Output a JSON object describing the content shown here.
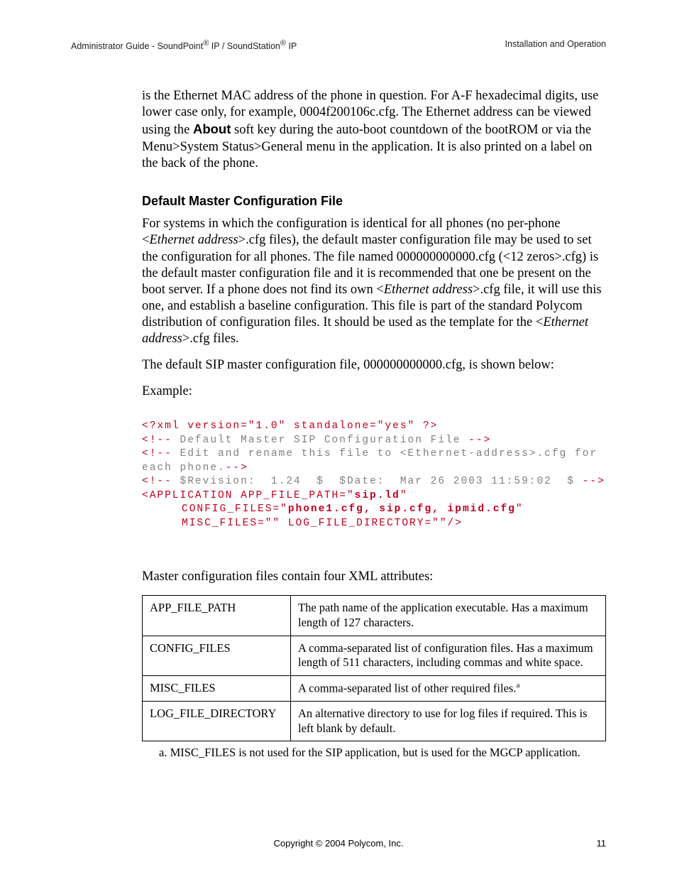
{
  "header": {
    "left_a": "Administrator Guide - SoundPoint",
    "left_reg1": "®",
    "left_b": " IP / SoundStation",
    "left_reg2": "®",
    "left_c": " IP",
    "right": "Installation and Operation"
  },
  "para1_a": "is the Ethernet MAC address of the phone in question.  For A-F hexadecimal digits, use lower case only, for example, 0004f200106c.cfg.  The Ethernet address can be viewed using the ",
  "para1_about": "About",
  "para1_b": " soft key during the auto-boot countdown of the bootROM or via the Menu>System Status>General menu in the application.  It is also printed on a label on the back of the phone.",
  "section_title": "Default Master Configuration File",
  "para2_a": "For systems in which the configuration is identical for all phones (no per-phone <",
  "para2_i1": "Ethernet address",
  "para2_b": ">.cfg files), the default master configuration file may be used to set the configuration for all phones.  The file named 000000000000.cfg (<12 zeros>.cfg) is the default master configuration file and it is recommended that one be present on the boot server.  If a phone does not find its own <",
  "para2_i2": "Ethernet address",
  "para2_c": ">.cfg file, it will use this one, and establish a baseline configuration.  This file is part of the standard Polycom distribution of configuration files.  It should be used as the template for the <",
  "para2_i3": "Ethernet address",
  "para2_d": ">.cfg files.",
  "para3": "The default SIP master configuration file, 000000000000.cfg, is shown below:",
  "para4": "Example:",
  "code": {
    "l1": "<?xml version=\"1.0\" standalone=\"yes\" ?>",
    "l2a": "<!-- ",
    "l2b": "Default Master SIP Configuration File",
    "l2c": " -->",
    "l3a": "<!-- ",
    "l3b": "Edit and rename this file to <Ethernet-address>.cfg for each phone.",
    "l3c": "-->",
    "l4a": "<!-- ",
    "l4b": "$Revision:  1.24  $  $Date:  Mar 26 2003 11:59:02  $",
    "l4c": " -->",
    "l5a": "<APPLICATION APP_FILE_PATH=\"",
    "l5b": "sip.ld",
    "l5c": "\"",
    "l6a": "CONFIG_FILES=\"",
    "l6b": "phone1.cfg, sip.cfg, ipmid.cfg",
    "l6c": "\"",
    "l7": "MISC_FILES=\"\" LOG_FILE_DIRECTORY=\"\"/>"
  },
  "para5": "Master configuration files contain four XML attributes:",
  "table": [
    {
      "name": "APP_FILE_PATH",
      "desc": "The path name of the application executable.  Has a maximum length of 127 characters."
    },
    {
      "name": "CONFIG_FILES",
      "desc": "A comma-separated list of configuration files.  Has a maximum length of 511 characters, including commas and white space."
    },
    {
      "name": "MISC_FILES",
      "desc_a": "A comma-separated list of other required files.",
      "sup": "a"
    },
    {
      "name": "LOG_FILE_DIRECTORY",
      "desc": "An alternative directory to use for log files if required.  This is left blank by default."
    }
  ],
  "footnote": "a.  MISC_FILES is not used for the SIP application, but is used for the MGCP application.",
  "footer": "Copyright © 2004 Polycom, Inc.",
  "pagenum": "11"
}
